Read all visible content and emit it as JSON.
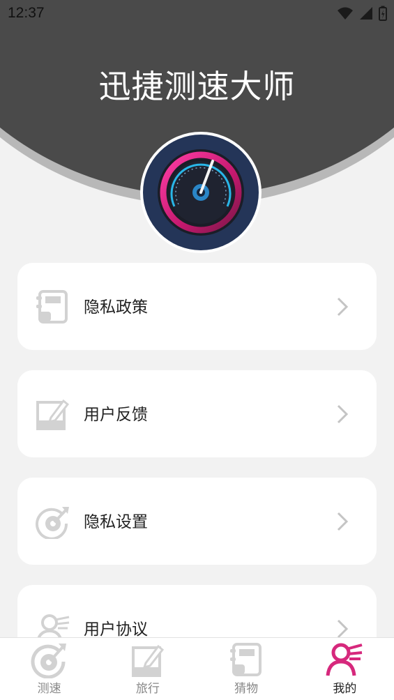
{
  "status_bar": {
    "time": "12:37"
  },
  "header": {
    "title": "迅捷测速大师"
  },
  "menu": {
    "items": [
      {
        "label": "隐私政策",
        "icon": "notebook-icon"
      },
      {
        "label": "用户反馈",
        "icon": "edit-icon"
      },
      {
        "label": "隐私设置",
        "icon": "target-icon"
      },
      {
        "label": "用户协议",
        "icon": "user-icon"
      }
    ]
  },
  "tabbar": {
    "tabs": [
      {
        "label": "测速",
        "icon": "speed-target-icon",
        "active": false
      },
      {
        "label": "旅行",
        "icon": "edit-icon",
        "active": false
      },
      {
        "label": "猜物",
        "icon": "notebook-icon",
        "active": false
      },
      {
        "label": "我的",
        "icon": "user-icon",
        "active": true
      }
    ]
  },
  "colors": {
    "header_bg": "#4a4a4a",
    "accent": "#d6287c",
    "icon_gray": "#d2d2d2",
    "background": "#f2f2f2"
  }
}
